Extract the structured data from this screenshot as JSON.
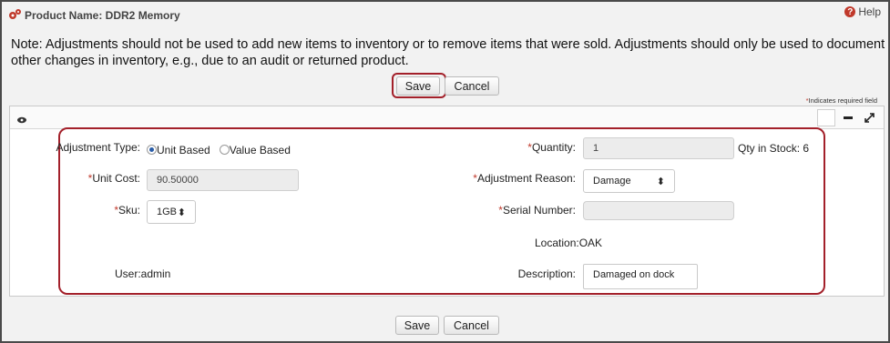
{
  "header": {
    "title": "Product Name: DDR2 Memory",
    "help_label": "Help",
    "help_glyph": "?"
  },
  "note": "Note: Adjustments should not be used to add new items to inventory or to remove items that were sold. Adjustments should only be used to document other changes in inventory, e.g., due to an audit or returned product.",
  "top_buttons": {
    "save": "Save",
    "cancel": "Cancel"
  },
  "bottom_buttons": {
    "save": "Save",
    "cancel": "Cancel"
  },
  "required_note": {
    "star": "*",
    "text": "Indicates required field"
  },
  "toolbar": {
    "eye_icon": "eye-icon",
    "square_icon": "square-icon",
    "minimize_icon": "minus-icon",
    "expand_icon": "expand-icon"
  },
  "form": {
    "adjustment_type": {
      "label": "Adjustment Type:",
      "options": [
        "Unit Based",
        "Value Based"
      ],
      "selected": "Unit Based"
    },
    "unit_cost": {
      "star": "*",
      "label": "Unit Cost:",
      "value": "90.50000"
    },
    "sku": {
      "star": "*",
      "label": "Sku:",
      "value": "1GB"
    },
    "user": "User:admin",
    "quantity": {
      "star": "*",
      "label": "Quantity:",
      "value": "1",
      "in_stock": "Qty in Stock: 6"
    },
    "adjustment_reason": {
      "star": "*",
      "label": "Adjustment Reason:",
      "value": "Damage"
    },
    "serial_number": {
      "star": "*",
      "label": "Serial Number:",
      "value": ""
    },
    "location": "Location:OAK",
    "description": {
      "label": "Description:",
      "value": "Damaged on dock"
    }
  },
  "colors": {
    "highlight": "#a3202a",
    "required": "#c0392b",
    "radio": "#2a5da8"
  }
}
